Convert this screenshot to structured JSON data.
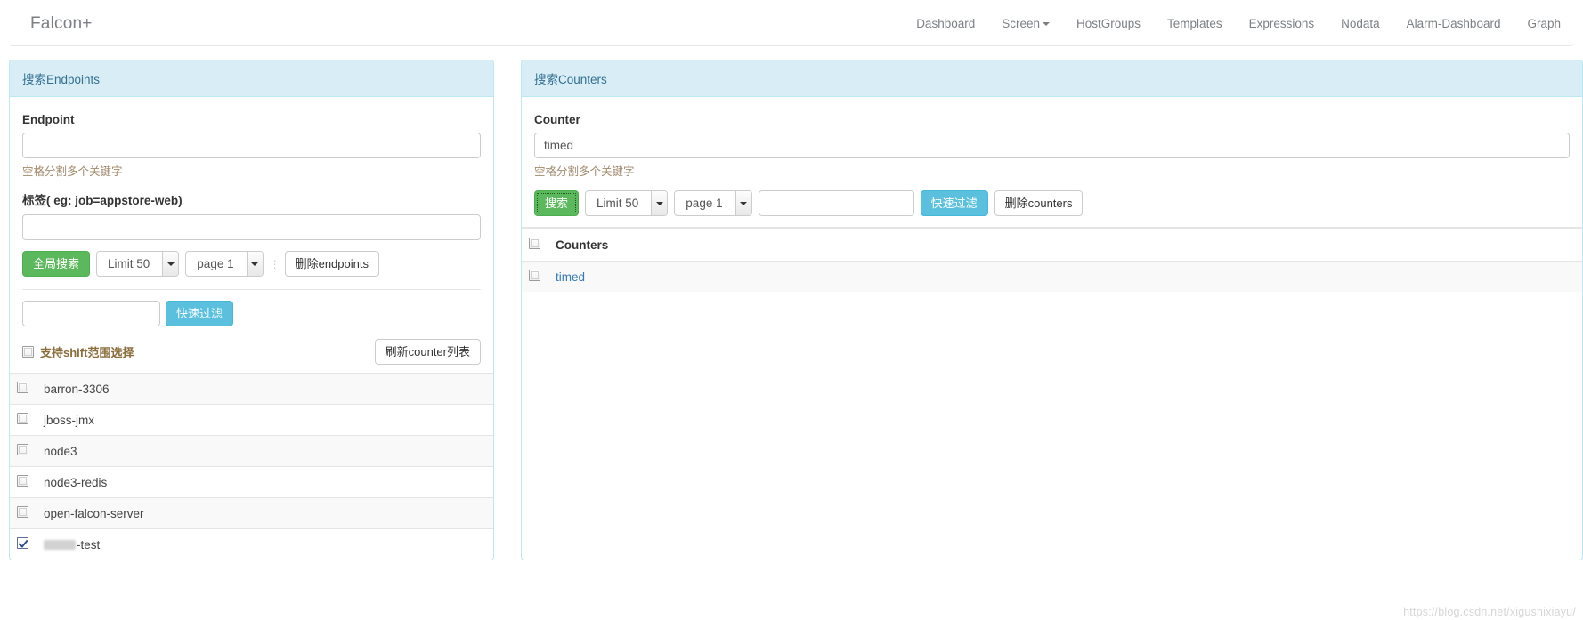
{
  "brand": {
    "label": "Falcon+"
  },
  "nav": {
    "items": [
      {
        "label": "Dashboard",
        "has_caret": false
      },
      {
        "label": "Screen",
        "has_caret": true
      },
      {
        "label": "HostGroups",
        "has_caret": false
      },
      {
        "label": "Templates",
        "has_caret": false
      },
      {
        "label": "Expressions",
        "has_caret": false
      },
      {
        "label": "Nodata",
        "has_caret": false
      },
      {
        "label": "Alarm-Dashboard",
        "has_caret": false
      },
      {
        "label": "Graph",
        "has_caret": false
      }
    ]
  },
  "endpoints_panel": {
    "heading": "搜索Endpoints",
    "endpoint_label": "Endpoint",
    "endpoint_value": "",
    "endpoint_help": "空格分割多个关键字",
    "tag_label": "标签( eg: job=appstore-web)",
    "tag_value": "",
    "search_button": "全局搜索",
    "limit_select": "Limit 50",
    "page_select": "page 1",
    "delete_button": "删除endpoints",
    "quick_filter_value": "",
    "quick_filter_button": "快速过滤",
    "shift_checkbox_label": "支持shift范围选择",
    "shift_checked": false,
    "refresh_button": "刷新counter列表",
    "rows": [
      {
        "label": "barron-3306",
        "checked": false,
        "redacted": false
      },
      {
        "label": "jboss-jmx",
        "checked": false,
        "redacted": false
      },
      {
        "label": "node3",
        "checked": false,
        "redacted": false
      },
      {
        "label": "node3-redis",
        "checked": false,
        "redacted": false
      },
      {
        "label": "open-falcon-server",
        "checked": false,
        "redacted": false
      },
      {
        "label": "-test",
        "checked": true,
        "redacted": true
      }
    ]
  },
  "counters_panel": {
    "heading": "搜索Counters",
    "counter_label": "Counter",
    "counter_value": "timed",
    "counter_help": "空格分割多个关键字",
    "search_button": "搜索",
    "limit_select": "Limit 50",
    "page_select": "page 1",
    "quick_filter_value": "",
    "quick_filter_button": "快速过滤",
    "delete_button": "删除counters",
    "table_header": "Counters",
    "rows": [
      {
        "label": "timed",
        "checked": false
      }
    ]
  },
  "watermark": {
    "text": "https://blog.csdn.net/xigushixiayu/"
  },
  "colors": {
    "panel_border": "#bce8f1",
    "panel_heading_bg": "#d9edf7",
    "panel_heading_text": "#31708f",
    "success": "#5cb85c",
    "info": "#5bc0de",
    "link": "#337ab7",
    "help_text": "#a08a6c",
    "shift_label": "#8a6d3b"
  }
}
